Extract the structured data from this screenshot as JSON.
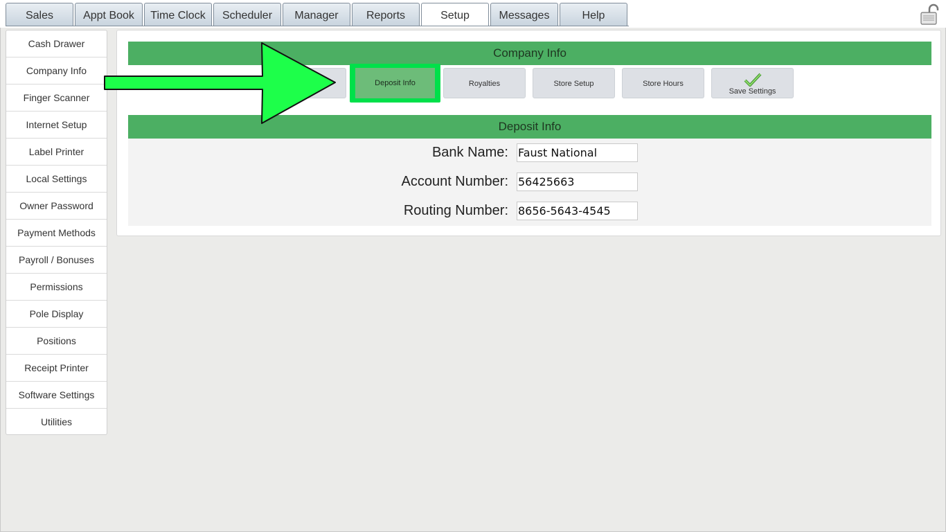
{
  "top_tabs": [
    "Sales",
    "Appt Book",
    "Time Clock",
    "Scheduler",
    "Manager",
    "Reports",
    "Setup",
    "Messages",
    "Help"
  ],
  "active_tab": "Setup",
  "sidebar": {
    "items": [
      "Cash Drawer",
      "Company Info",
      "Finger Scanner",
      "Internet Setup",
      "Label Printer",
      "Local Settings",
      "Owner Password",
      "Payment Methods",
      "Payroll / Bonuses",
      "Permissions",
      "Pole Display",
      "Positions",
      "Receipt Printer",
      "Software Settings",
      "Utilities"
    ]
  },
  "company_info": {
    "title": "Company Info",
    "buttons": {
      "deposit": "Deposit Info",
      "royalties": "Royalties",
      "store_setup": "Store Setup",
      "store_hours": "Store Hours",
      "save": "Save Settings"
    }
  },
  "deposit_info": {
    "title": "Deposit Info",
    "bank_name_label": "Bank Name:",
    "bank_name": "Faust National",
    "account_number_label": "Account Number:",
    "account_number": "56425663",
    "routing_number_label": "Routing Number:",
    "routing_number": "8656-5643-4545"
  },
  "colors": {
    "section_green": "#4caf63",
    "highlight_green": "#00e04a",
    "arrow_green": "#1dff4a"
  }
}
